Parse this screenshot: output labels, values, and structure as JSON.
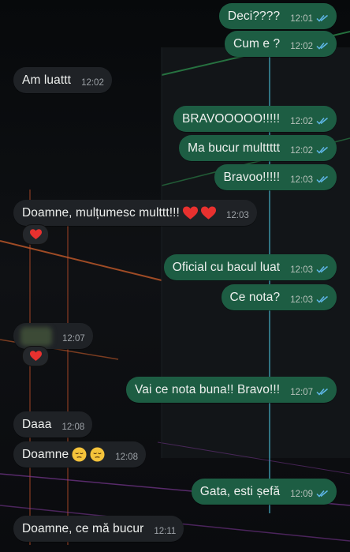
{
  "colors": {
    "outgoing_bubble": "#1d5d43",
    "incoming_bubble": "#1f2226",
    "read_ticks": "#5fb7e8",
    "text": "#eef0ee"
  },
  "messages": [
    {
      "dir": "out",
      "text": "Deci????",
      "time": "12:01",
      "status": "read"
    },
    {
      "dir": "out",
      "text": "Cum e ?",
      "time": "12:02",
      "status": "read"
    },
    {
      "dir": "in",
      "text": "Am luattt",
      "time": "12:02"
    },
    {
      "dir": "out",
      "text": "BRAVOOOOO!!!!!",
      "time": "12:02",
      "status": "read"
    },
    {
      "dir": "out",
      "text": "Ma bucur multtttt",
      "time": "12:02",
      "status": "read"
    },
    {
      "dir": "out",
      "text": "Bravoo!!!!!",
      "time": "12:03",
      "status": "read"
    },
    {
      "dir": "in",
      "text": "Doamne, mulțumesc multtt!!!",
      "time": "12:03",
      "emoji": [
        "red-heart",
        "red-heart"
      ],
      "reaction": "red-heart"
    },
    {
      "dir": "out",
      "text": "Oficial cu bacul luat",
      "time": "12:03",
      "status": "read"
    },
    {
      "dir": "out",
      "text": "Ce nota?",
      "time": "12:03",
      "status": "read"
    },
    {
      "dir": "in",
      "text": "",
      "time": "12:07",
      "content": "blurred-sticker",
      "reaction": "red-heart"
    },
    {
      "dir": "out",
      "text": "Vai ce nota buna!! Bravo!!!",
      "time": "12:07",
      "status": "read"
    },
    {
      "dir": "in",
      "text": "Daaa",
      "time": "12:08"
    },
    {
      "dir": "in",
      "text": "Doamne",
      "time": "12:08",
      "emoji": [
        "relieved-face",
        "relieved-face"
      ]
    },
    {
      "dir": "out",
      "text": "Gata, esti șefă",
      "time": "12:09",
      "status": "read"
    },
    {
      "dir": "in",
      "text": "Doamne, ce mă bucur",
      "time": "12:11"
    }
  ]
}
